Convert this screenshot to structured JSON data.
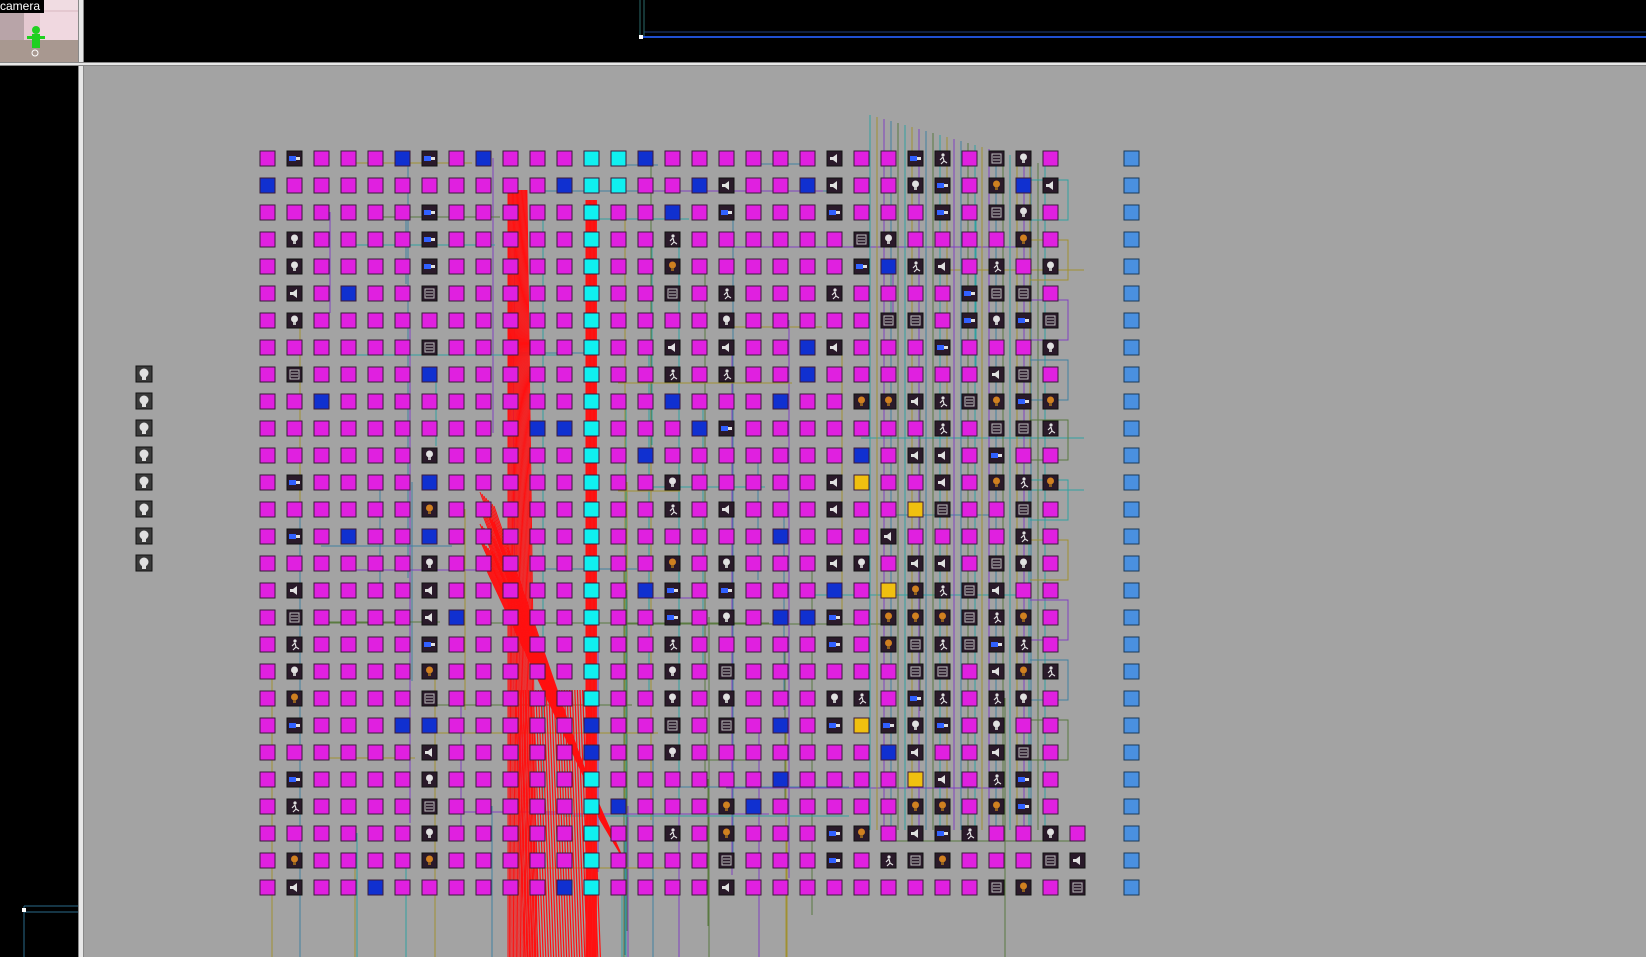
{
  "camera_view": {
    "label": "camera",
    "thumbnail": "camera-thumbnail"
  },
  "top_view": {
    "name": "top-grid-viewport"
  },
  "side_view": {
    "name": "side-grid-viewport"
  },
  "main_view": {
    "name": "2d-entity-view"
  },
  "colors": {
    "viewport_bg": "#000000",
    "grid_line": "#5a5a5a",
    "main_bg": "#a3a3a3",
    "entity_magenta": "#e020e0",
    "entity_cyan": "#10f0f0",
    "entity_blue": "#1030d0",
    "entity_yellow": "#f0c010",
    "entity_lightblue": "#4a90e0",
    "entity_dark": "#2a1a2a",
    "connector_red": "#ff1010",
    "connector_teal": "#30a0a0",
    "connector_olive": "#a09030",
    "connector_purple": "#8040c0"
  },
  "entity_icons": [
    "lightbulb-icon",
    "speaker-icon",
    "terminal-icon",
    "runner-icon",
    "camera-icon",
    "sprite-icon"
  ]
}
